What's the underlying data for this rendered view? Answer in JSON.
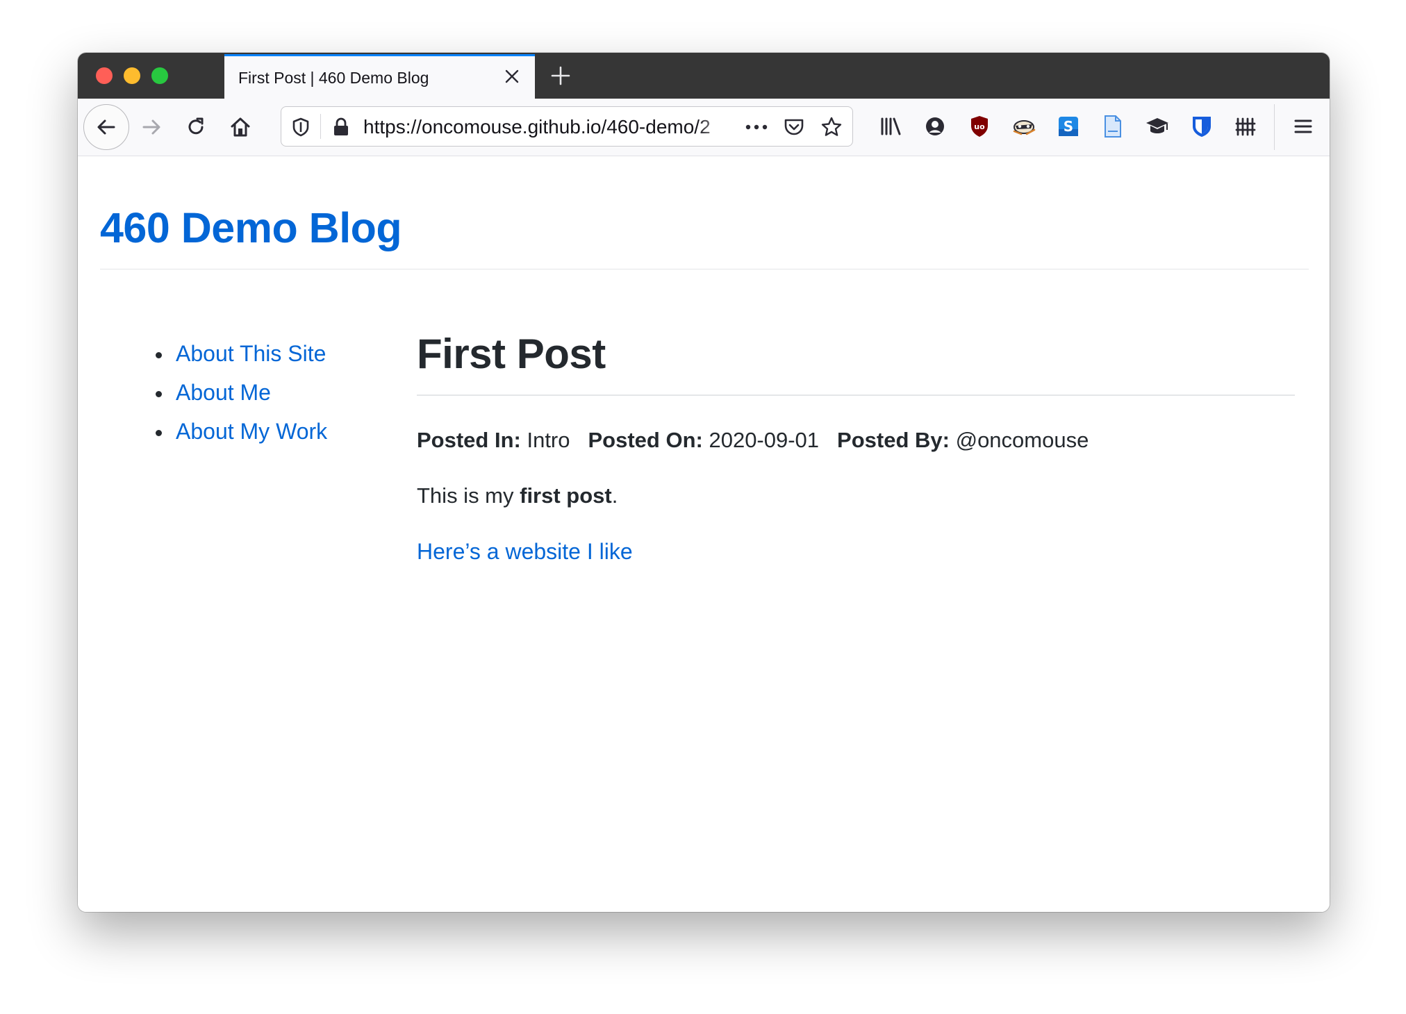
{
  "browser": {
    "tab": {
      "title": "First Post | 460 Demo Blog"
    },
    "url": "https://oncomouse.github.io/460-demo/2",
    "toolbar_icons": [
      "library-icon",
      "account-icon",
      "ublock-icon",
      "raccoon-extension-icon",
      "s-extension-icon",
      "document-icon",
      "graduation-cap-icon",
      "bitwarden-icon",
      "fence-icon",
      "hamburger-menu-icon"
    ]
  },
  "site": {
    "title": "460 Demo Blog"
  },
  "sidebar": {
    "items": [
      {
        "label": "About This Site"
      },
      {
        "label": "About Me"
      },
      {
        "label": "About My Work"
      }
    ]
  },
  "post": {
    "title": "First Post",
    "meta": {
      "category_label": "Posted In:",
      "category": "Intro",
      "date_label": "Posted On:",
      "date": "2020-09-01",
      "author_label": "Posted By:",
      "author": "@oncomouse"
    },
    "body": {
      "before": "This is my ",
      "bold": "first post",
      "after": "."
    },
    "link_text": "Here’s a website I like"
  },
  "colors": {
    "link": "#0366d6",
    "text": "#24292e",
    "tab_accent": "#0a84ff",
    "tabstrip": "#363636"
  }
}
